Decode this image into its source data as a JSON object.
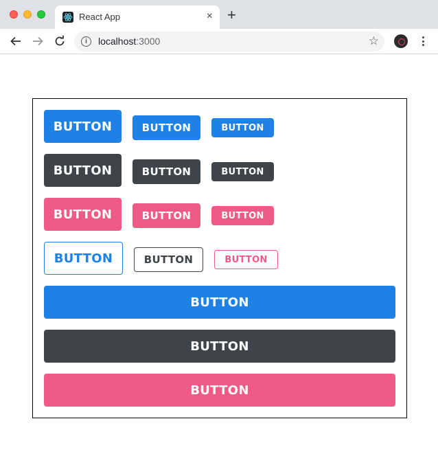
{
  "browser": {
    "tab_title": "React App",
    "tab_close_glyph": "×",
    "new_tab_glyph": "+",
    "url_host": "localhost",
    "url_port": ":3000"
  },
  "icons": {
    "back": "back-arrow-icon",
    "forward": "forward-arrow-icon",
    "reload": "reload-icon",
    "info": "info-icon",
    "bookmark": "star-icon",
    "extension": "extension-icon",
    "menu": "kebab-menu-icon",
    "favicon": "react-logo-icon"
  },
  "colors": {
    "primary": "#1e81e5",
    "secondary": "#3f444b",
    "danger": "#ef5a87"
  },
  "buttons": {
    "primary_large": "BUTTON",
    "primary_medium": "BUTTON",
    "primary_small": "BUTTON",
    "secondary_large": "BUTTON",
    "secondary_medium": "BUTTON",
    "secondary_small": "BUTTON",
    "danger_large": "BUTTON",
    "danger_medium": "BUTTON",
    "danger_small": "BUTTON",
    "outline_primary_large": "BUTTON",
    "outline_secondary_medium": "BUTTON",
    "outline_danger_small": "BUTTON",
    "primary_block": "BUTTON",
    "secondary_block": "BUTTON",
    "danger_block": "BUTTON"
  }
}
